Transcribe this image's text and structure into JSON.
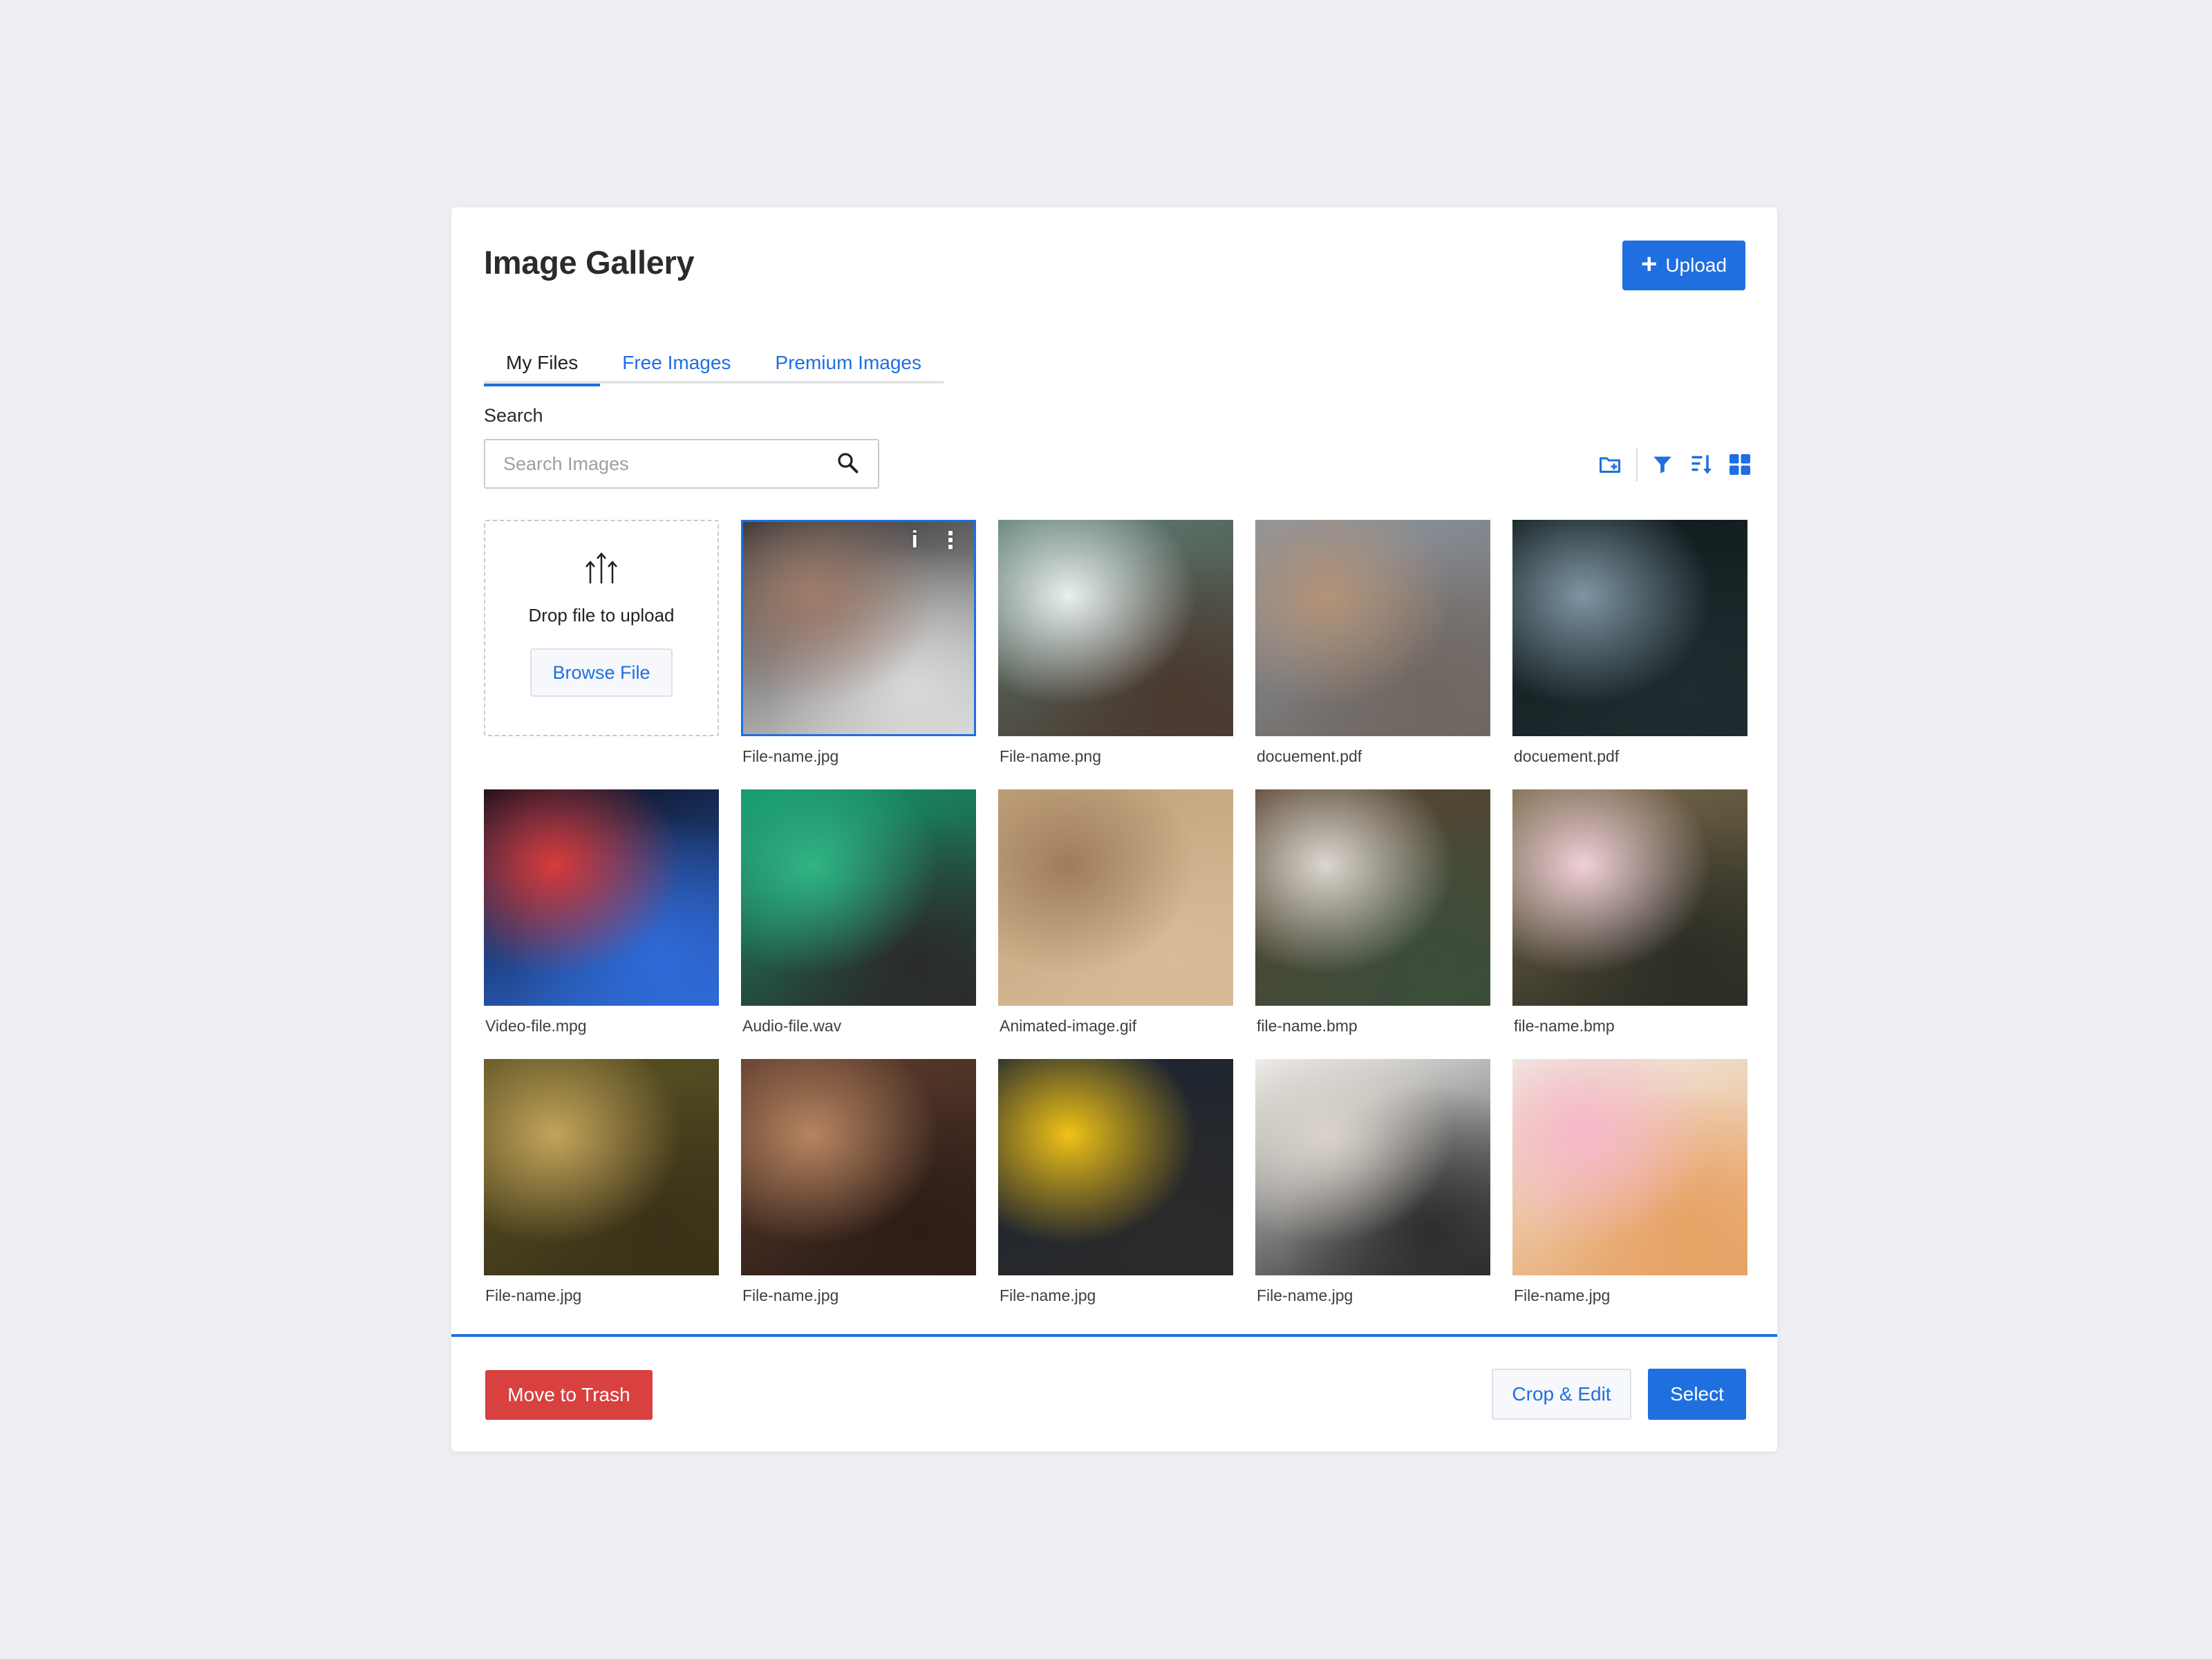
{
  "header": {
    "title": "Image Gallery",
    "upload_label": "Upload"
  },
  "tabs": [
    {
      "label": "My Files",
      "active": true
    },
    {
      "label": "Free Images",
      "active": false
    },
    {
      "label": "Premium Images",
      "active": false
    }
  ],
  "search": {
    "label": "Search",
    "placeholder": "Search Images",
    "value": ""
  },
  "toolbar": {
    "icons": [
      "new-folder-icon",
      "filter-icon",
      "sort-icon",
      "grid-view-icon"
    ]
  },
  "dropzone": {
    "text": "Drop file to upload",
    "browse_label": "Browse File"
  },
  "files": [
    {
      "name": "File-name.jpg",
      "selected": true,
      "colors": [
        "#2c2c2e",
        "#a07c6a",
        "#d9d9d9"
      ]
    },
    {
      "name": "File-name.png",
      "colors": [
        "#5c7f76",
        "#e8efef",
        "#4a3a30"
      ]
    },
    {
      "name": "docuement.pdf",
      "colors": [
        "#8c97a2",
        "#b49378",
        "#6f6660"
      ]
    },
    {
      "name": "docuement.pdf",
      "colors": [
        "#0f1a1c",
        "#7f95a3",
        "#1f2b2e"
      ]
    },
    {
      "name": "Video-file.mpg",
      "colors": [
        "#0b0b14",
        "#d83b3b",
        "#2f6bd8"
      ]
    },
    {
      "name": "Audio-file.wav",
      "colors": [
        "#149a6e",
        "#30b585",
        "#2b2b2b"
      ]
    },
    {
      "name": "Animated-image.gif",
      "colors": [
        "#c2a27c",
        "#9f7d5b",
        "#d6bb96"
      ]
    },
    {
      "name": "file-name.bmp",
      "colors": [
        "#5a4332",
        "#dcd7cf",
        "#3b4d3a"
      ]
    },
    {
      "name": "file-name.bmp",
      "colors": [
        "#7a6a4a",
        "#f0d0d8",
        "#2c2e25"
      ]
    },
    {
      "name": "File-name.jpg",
      "colors": [
        "#5c5424",
        "#c4a45a",
        "#3a3218"
      ]
    },
    {
      "name": "File-name.jpg",
      "colors": [
        "#5e3d2e",
        "#b78560",
        "#2c1d17"
      ]
    },
    {
      "name": "File-name.jpg",
      "colors": [
        "#1b2431",
        "#f0c216",
        "#2a2a2a"
      ]
    },
    {
      "name": "File-name.jpg",
      "colors": [
        "#f4f2ef",
        "#d9d3cb",
        "#2d2d2d"
      ]
    },
    {
      "name": "File-name.jpg",
      "colors": [
        "#f1ede7",
        "#f6b6c8",
        "#e7a264"
      ]
    }
  ],
  "footer": {
    "trash_label": "Move to Trash",
    "crop_label": "Crop & Edit",
    "select_label": "Select"
  },
  "colors": {
    "accent": "#1f6fe0",
    "danger": "#d94040",
    "background": "#edeef2"
  }
}
